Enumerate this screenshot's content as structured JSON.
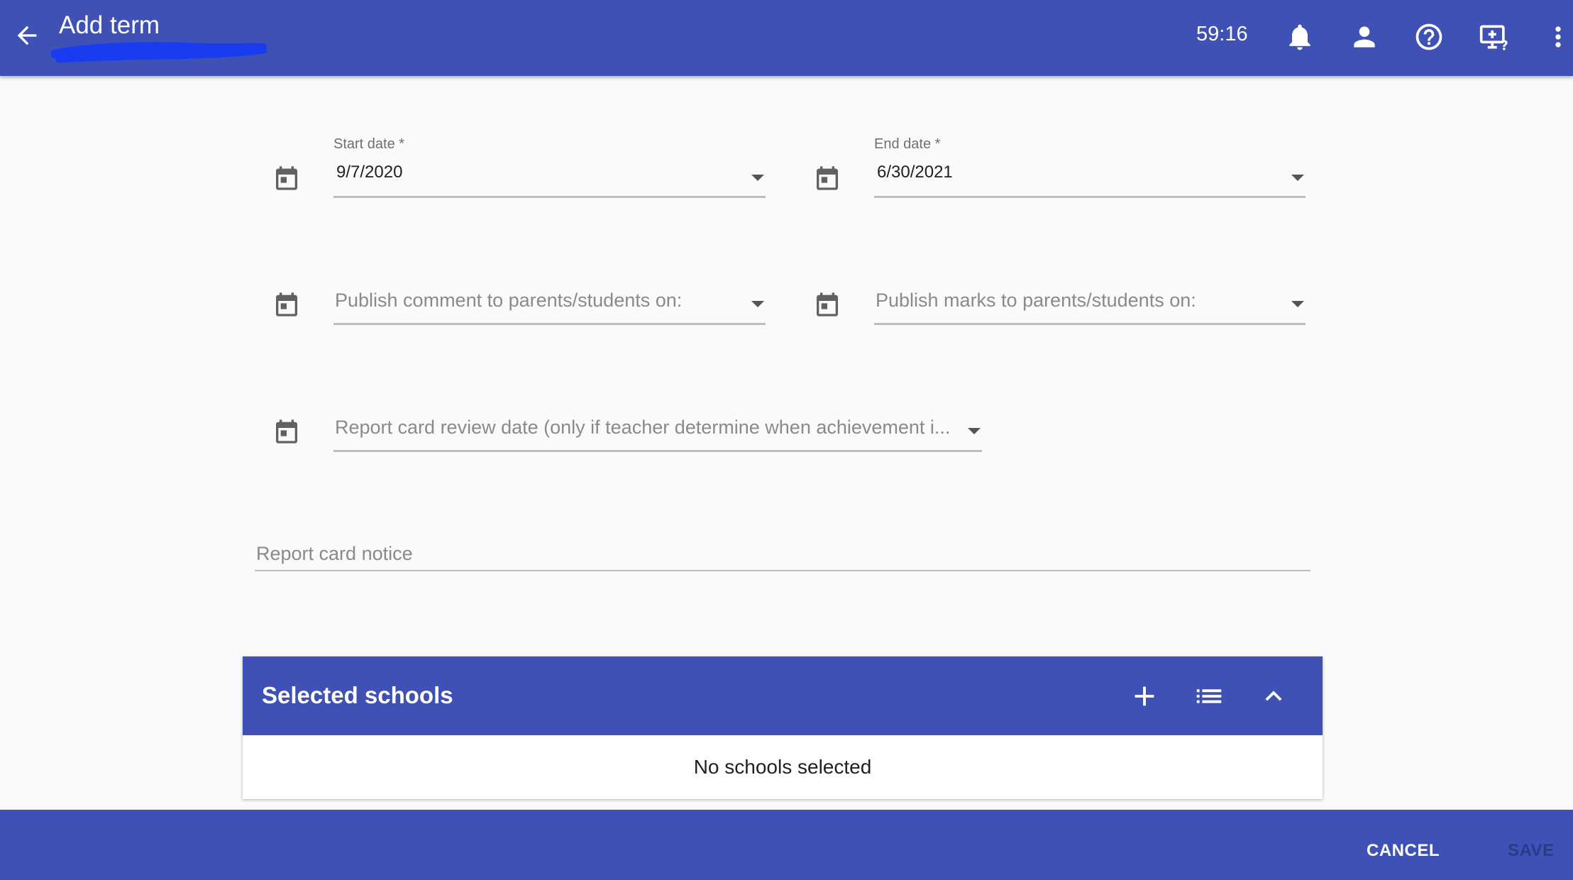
{
  "header": {
    "title": "Add term",
    "timer": "59:16",
    "icons": [
      "back-arrow-icon",
      "bell-icon",
      "account-icon",
      "help-icon",
      "screen-help-icon",
      "more-vert-icon"
    ]
  },
  "form": {
    "start_date": {
      "label": "Start date *",
      "value": "9/7/2020"
    },
    "end_date": {
      "label": "End date *",
      "value": "6/30/2021"
    },
    "publish_comment": {
      "placeholder": "Publish comment to parents/students on:"
    },
    "publish_marks": {
      "placeholder": "Publish marks to parents/students on:"
    },
    "report_card_review": {
      "placeholder": "Report card review date (only if teacher determine when achievement i..."
    },
    "report_card_notice": {
      "placeholder": "Report card notice"
    }
  },
  "schools_panel": {
    "title": "Selected schools",
    "empty_text": "No schools selected",
    "icons": [
      "add-icon",
      "list-icon",
      "chevron-up-icon"
    ]
  },
  "footer": {
    "cancel_label": "CANCEL",
    "save_label": "SAVE"
  },
  "colors": {
    "primary": "#3f51b5",
    "background": "#fafafa",
    "disabled_text": "#2b3a87"
  }
}
